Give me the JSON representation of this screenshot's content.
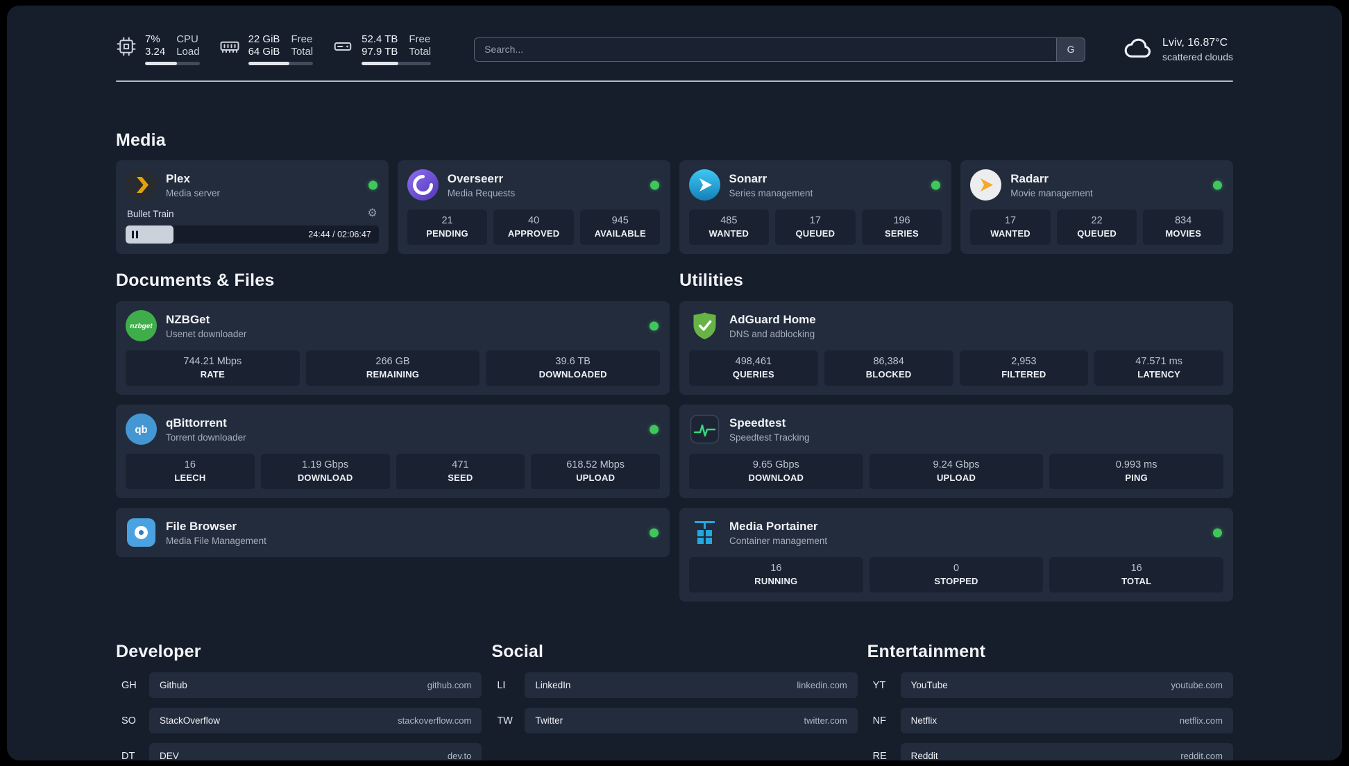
{
  "topbar": {
    "cpu": {
      "value_top": "7%",
      "value_bottom": "3.24",
      "label_top": "CPU",
      "label_bottom": "Load",
      "bar_percent": 58
    },
    "ram": {
      "value_top": "22 GiB",
      "value_bottom": "64 GiB",
      "label_top": "Free",
      "label_bottom": "Total",
      "bar_percent": 64
    },
    "disk": {
      "value_top": "52.4 TB",
      "value_bottom": "97.9 TB",
      "label_top": "Free",
      "label_bottom": "Total",
      "bar_percent": 53
    },
    "search": {
      "placeholder": "Search...",
      "engine_label": "G"
    },
    "weather": {
      "location": "Lviv, 16.87°C",
      "condition": "scattered clouds"
    }
  },
  "sections": {
    "media": "Media",
    "documents": "Documents & Files",
    "utilities": "Utilities",
    "developer": "Developer",
    "social": "Social",
    "entertainment": "Entertainment"
  },
  "icons": {
    "gear": "⚙"
  },
  "colors": {
    "page_bg": "#161d2b",
    "card_bg": "#232c3d",
    "tile_bg": "#1a2232",
    "status_online": "#3fc75c",
    "plex_accent": "#e5a00d",
    "overseerr_purple": "#6a4fd0",
    "sonarr_blue": "#1b9ad1",
    "radarr_amber": "#f7b32b",
    "nzbget_green": "#3fae4a",
    "qbittorrent_blue": "#4597d3",
    "filebrowser_blue": "#4aa3e0",
    "adguard_green": "#67b346",
    "speedtest_green": "#37d67a",
    "portainer_blue": "#23a8e0"
  },
  "apps": {
    "plex": {
      "name": "Plex",
      "desc": "Media server",
      "online": true,
      "now_playing": {
        "title": "Bullet Train",
        "time": "24:44 / 02:06:47",
        "progress_percent": 19
      }
    },
    "overseerr": {
      "name": "Overseerr",
      "desc": "Media Requests",
      "online": true,
      "stats": [
        {
          "value": "21",
          "label": "PENDING"
        },
        {
          "value": "40",
          "label": "APPROVED"
        },
        {
          "value": "945",
          "label": "AVAILABLE"
        }
      ]
    },
    "sonarr": {
      "name": "Sonarr",
      "desc": "Series management",
      "online": true,
      "stats": [
        {
          "value": "485",
          "label": "WANTED"
        },
        {
          "value": "17",
          "label": "QUEUED"
        },
        {
          "value": "196",
          "label": "SERIES"
        }
      ]
    },
    "radarr": {
      "name": "Radarr",
      "desc": "Movie management",
      "online": true,
      "stats": [
        {
          "value": "17",
          "label": "WANTED"
        },
        {
          "value": "22",
          "label": "QUEUED"
        },
        {
          "value": "834",
          "label": "MOVIES"
        }
      ]
    },
    "nzbget": {
      "name": "NZBGet",
      "desc": "Usenet downloader",
      "online": true,
      "stats": [
        {
          "value": "744.21 Mbps",
          "label": "RATE"
        },
        {
          "value": "266 GB",
          "label": "REMAINING"
        },
        {
          "value": "39.6 TB",
          "label": "DOWNLOADED"
        }
      ]
    },
    "qbittorrent": {
      "name": "qBittorrent",
      "desc": "Torrent downloader",
      "online": true,
      "stats": [
        {
          "value": "16",
          "label": "LEECH"
        },
        {
          "value": "1.19 Gbps",
          "label": "DOWNLOAD"
        },
        {
          "value": "471",
          "label": "SEED"
        },
        {
          "value": "618.52 Mbps",
          "label": "UPLOAD"
        }
      ]
    },
    "filebrowser": {
      "name": "File Browser",
      "desc": "Media File Management",
      "online": true
    },
    "adguard": {
      "name": "AdGuard Home",
      "desc": "DNS and adblocking",
      "online": false,
      "stats": [
        {
          "value": "498,461",
          "label": "QUERIES"
        },
        {
          "value": "86,384",
          "label": "BLOCKED"
        },
        {
          "value": "2,953",
          "label": "FILTERED"
        },
        {
          "value": "47.571 ms",
          "label": "LATENCY"
        }
      ]
    },
    "speedtest": {
      "name": "Speedtest",
      "desc": "Speedtest Tracking",
      "online": false,
      "stats": [
        {
          "value": "9.65 Gbps",
          "label": "DOWNLOAD"
        },
        {
          "value": "9.24 Gbps",
          "label": "UPLOAD"
        },
        {
          "value": "0.993 ms",
          "label": "PING"
        }
      ]
    },
    "portainer": {
      "name": "Media Portainer",
      "desc": "Container management",
      "online": true,
      "stats": [
        {
          "value": "16",
          "label": "RUNNING"
        },
        {
          "value": "0",
          "label": "STOPPED"
        },
        {
          "value": "16",
          "label": "TOTAL"
        }
      ]
    }
  },
  "bookmarks": {
    "developer": [
      {
        "abbr": "GH",
        "name": "Github",
        "url": "github.com"
      },
      {
        "abbr": "SO",
        "name": "StackOverflow",
        "url": "stackoverflow.com"
      },
      {
        "abbr": "DT",
        "name": "DEV",
        "url": "dev.to"
      }
    ],
    "social": [
      {
        "abbr": "LI",
        "name": "LinkedIn",
        "url": "linkedin.com"
      },
      {
        "abbr": "TW",
        "name": "Twitter",
        "url": "twitter.com"
      }
    ],
    "entertainment": [
      {
        "abbr": "YT",
        "name": "YouTube",
        "url": "youtube.com"
      },
      {
        "abbr": "NF",
        "name": "Netflix",
        "url": "netflix.com"
      },
      {
        "abbr": "RE",
        "name": "Reddit",
        "url": "reddit.com"
      }
    ]
  }
}
